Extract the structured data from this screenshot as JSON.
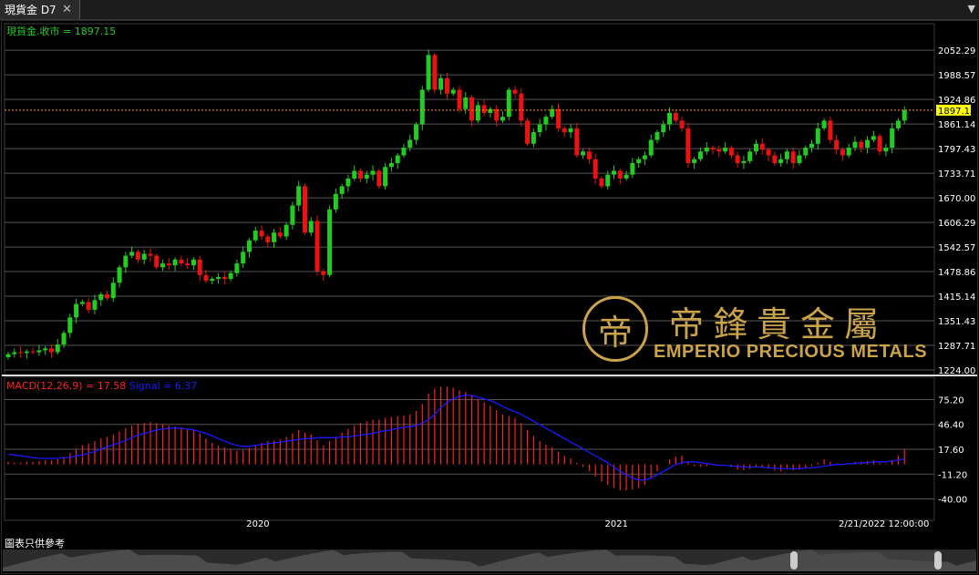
{
  "tab": {
    "title": "現貨金 D7",
    "close_glyph": "✕",
    "menu_glyph": "▼"
  },
  "price_legend": "現貨金.收市 = 1897.15",
  "macd_legend": {
    "macd": "MACD(12,26,9) = 17.58",
    "signal": "Signal = 6.37"
  },
  "footnote": "圖表只供參考",
  "logo": {
    "mark": "帝",
    "cn": "帝鋒貴金屬",
    "en": "EMPERIO PRECIOUS METALS"
  },
  "colors": {
    "up": "#22cc22",
    "down": "#ee1111",
    "macd": "#ff2020",
    "signal": "#1a1aff",
    "last_line": "#ff9900",
    "last_label_bg": "#ffff00",
    "gold": "#c9a24a"
  },
  "chart_data": [
    {
      "type": "candlestick",
      "series_label": "現貨金.收市",
      "last_value": 1897.15,
      "last_value_label": "1897.15",
      "ylim": [
        1224.0,
        2081.0
      ],
      "y_ticks": [
        "2052.29",
        "1988.57",
        "1924.86",
        "1861.14",
        "1797.43",
        "1733.71",
        "1670.00",
        "1606.29",
        "1542.57",
        "1478.86",
        "1415.14",
        "1351.43",
        "1287.71",
        "1224.00"
      ],
      "x_ticks": [
        "2020",
        "2021",
        "2/21/2022 12:00:00"
      ],
      "closes": [
        1265,
        1270,
        1268,
        1272,
        1270,
        1275,
        1280,
        1270,
        1290,
        1320,
        1360,
        1395,
        1400,
        1380,
        1405,
        1420,
        1410,
        1450,
        1490,
        1520,
        1530,
        1510,
        1525,
        1520,
        1490,
        1500,
        1495,
        1510,
        1500,
        1495,
        1510,
        1470,
        1455,
        1460,
        1465,
        1460,
        1475,
        1500,
        1530,
        1560,
        1585,
        1570,
        1555,
        1580,
        1570,
        1600,
        1650,
        1700,
        1580,
        1610,
        1480,
        1470,
        1640,
        1680,
        1700,
        1720,
        1740,
        1720,
        1730,
        1740,
        1700,
        1750,
        1760,
        1780,
        1800,
        1820,
        1860,
        1950,
        2040,
        1950,
        1980,
        1940,
        1950,
        1900,
        1930,
        1870,
        1910,
        1890,
        1900,
        1870,
        1880,
        1950,
        1940,
        1870,
        1810,
        1840,
        1860,
        1880,
        1900,
        1850,
        1840,
        1850,
        1780,
        1790,
        1770,
        1720,
        1700,
        1730,
        1740,
        1720,
        1730,
        1760,
        1770,
        1780,
        1820,
        1840,
        1860,
        1890,
        1870,
        1850,
        1760,
        1770,
        1790,
        1800,
        1795,
        1790,
        1800,
        1780,
        1760,
        1765,
        1790,
        1810,
        1795,
        1780,
        1760,
        1770,
        1790,
        1760,
        1780,
        1800,
        1810,
        1850,
        1870,
        1820,
        1795,
        1780,
        1800,
        1815,
        1800,
        1820,
        1830,
        1790,
        1800,
        1850,
        1870,
        1897.15
      ]
    },
    {
      "type": "line",
      "title": "MACD(12,26,9)",
      "ylim": [
        -50.0,
        100.0
      ],
      "y_ticks": [
        "75.20",
        "46.40",
        "17.60",
        "-11.20",
        "-40.00"
      ],
      "series": [
        {
          "name": "MACD(12,26,9)",
          "style": "bars",
          "last_value": 17.58,
          "values": [
            3,
            2,
            2,
            3,
            3,
            4,
            5,
            5,
            6,
            9,
            13,
            18,
            22,
            24,
            27,
            30,
            32,
            35,
            38,
            42,
            45,
            47,
            48,
            49,
            48,
            47,
            45,
            44,
            43,
            41,
            39,
            36,
            30,
            25,
            22,
            20,
            18,
            16,
            17,
            19,
            22,
            25,
            27,
            28,
            29,
            32,
            36,
            40,
            37,
            35,
            28,
            22,
            27,
            32,
            37,
            41,
            45,
            48,
            50,
            52,
            52,
            54,
            55,
            56,
            57,
            58,
            62,
            70,
            82,
            88,
            90,
            90,
            89,
            86,
            84,
            80,
            76,
            72,
            68,
            63,
            58,
            56,
            54,
            48,
            40,
            33,
            27,
            23,
            20,
            15,
            10,
            7,
            2,
            -3,
            -8,
            -14,
            -20,
            -24,
            -27,
            -30,
            -30,
            -29,
            -27,
            -24,
            -16,
            -8,
            0,
            6,
            9,
            10,
            3,
            -2,
            -3,
            -2,
            -1,
            -1,
            0,
            -3,
            -6,
            -7,
            -5,
            -3,
            -4,
            -5,
            -7,
            -8,
            -6,
            -7,
            -6,
            -4,
            -2,
            2,
            6,
            3,
            1,
            -1,
            1,
            3,
            3,
            4,
            5,
            2,
            1,
            5,
            10,
            17.58
          ]
        },
        {
          "name": "Signal",
          "style": "line",
          "last_value": 6.37,
          "values": [
            12,
            11,
            10,
            9,
            8,
            7,
            7,
            7,
            7,
            8,
            8,
            10,
            11,
            13,
            15,
            18,
            20,
            23,
            25,
            28,
            31,
            34,
            36,
            38,
            40,
            41,
            42,
            42,
            42,
            41,
            40,
            38,
            36,
            33,
            30,
            27,
            24,
            22,
            21,
            21,
            22,
            23,
            24,
            25,
            26,
            27,
            28,
            29,
            30,
            30,
            31,
            31,
            31,
            31,
            32,
            32,
            33,
            34,
            35,
            36,
            38,
            39,
            40,
            42,
            43,
            44,
            45,
            48,
            52,
            58,
            66,
            72,
            76,
            79,
            80,
            80,
            78,
            76,
            74,
            71,
            67,
            64,
            61,
            58,
            54,
            50,
            46,
            42,
            38,
            34,
            30,
            26,
            22,
            18,
            14,
            10,
            6,
            2,
            -3,
            -8,
            -12,
            -16,
            -18,
            -18,
            -16,
            -12,
            -8,
            -4,
            0,
            2,
            3,
            3,
            2,
            1,
            0,
            -1,
            -1,
            -2,
            -2,
            -3,
            -3,
            -3,
            -3,
            -4,
            -4,
            -5,
            -5,
            -5,
            -5,
            -4,
            -4,
            -3,
            -2,
            -1,
            0,
            0,
            1,
            1,
            2,
            2,
            3,
            3,
            3,
            4,
            5,
            6.37
          ]
        }
      ]
    }
  ]
}
